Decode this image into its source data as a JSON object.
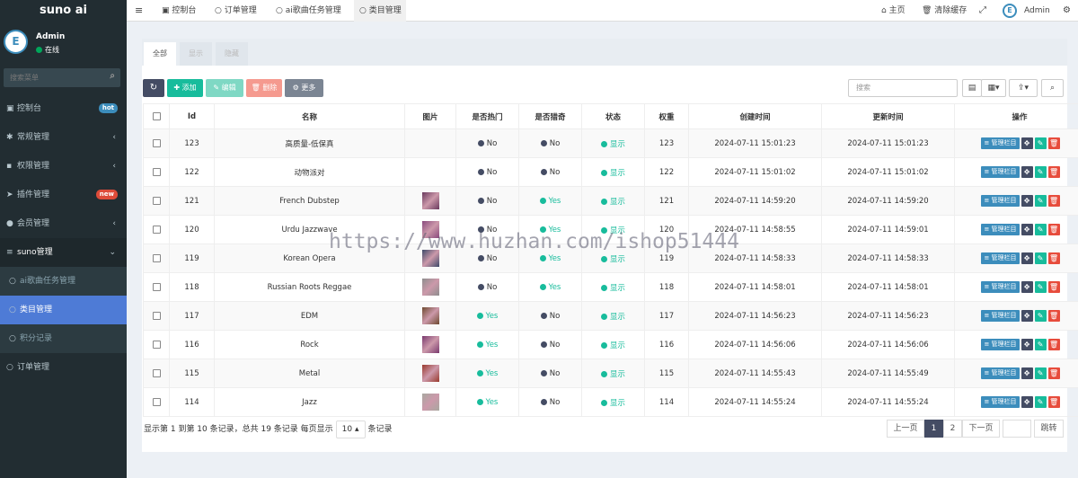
{
  "sidebar": {
    "logo": "suno ai",
    "avatar_text": "E",
    "user_name": "Admin",
    "user_status": "在线",
    "search_placeholder": "搜索菜单",
    "items": [
      {
        "icon": "dashboard-icon",
        "glyph": "▣",
        "label": "控制台",
        "badge": "hot",
        "badge_color": "#3c8dbc"
      },
      {
        "icon": "cogs-icon",
        "glyph": "✱",
        "label": "常规管理",
        "arrow": "‹"
      },
      {
        "icon": "group-icon",
        "glyph": "▪",
        "label": "权限管理",
        "arrow": "‹"
      },
      {
        "icon": "rocket-icon",
        "glyph": "➤",
        "label": "插件管理",
        "badge": "new",
        "badge_color": "#dd4b39"
      },
      {
        "icon": "user-circle-icon",
        "glyph": "●",
        "label": "会员管理",
        "arrow": "‹"
      },
      {
        "icon": "list-icon",
        "glyph": "≡",
        "label": "suno管理",
        "arrow": "⌄"
      }
    ],
    "subitems": [
      {
        "label": "ai歌曲任务管理",
        "active": false
      },
      {
        "label": "类目管理",
        "active": true
      },
      {
        "label": "积分记录",
        "active": false
      }
    ],
    "last_item": {
      "icon": "circle-icon",
      "label": "订单管理"
    }
  },
  "topbar": {
    "tabs": [
      {
        "label": "控制台",
        "icon": "dashboard-icon",
        "glyph": "▣"
      },
      {
        "label": "订单管理",
        "icon": "circle-icon",
        "glyph": "○"
      },
      {
        "label": "ai歌曲任务管理",
        "icon": "circle-icon",
        "glyph": "○"
      },
      {
        "label": "类目管理",
        "icon": "circle-icon",
        "glyph": "○"
      }
    ],
    "home": "主页",
    "clear_cache": "清除缓存",
    "admin": "Admin"
  },
  "content_tabs": [
    "全部",
    "显示",
    "隐藏"
  ],
  "toolbar": {
    "add": "添加",
    "edit": "编辑",
    "delete": "删除",
    "more": "更多",
    "search_placeholder": "搜索"
  },
  "table": {
    "headers": [
      "Id",
      "名称",
      "图片",
      "是否热门",
      "是否猎奇",
      "状态",
      "权重",
      "创建时间",
      "更新时间",
      "操作"
    ],
    "rows": [
      {
        "id": "123",
        "name": "高质量-低保真",
        "img": "",
        "hot": "No",
        "odd": "No",
        "status": "显示",
        "weight": "123",
        "created": "2024-07-11 15:01:23",
        "updated": "2024-07-11 15:01:23"
      },
      {
        "id": "122",
        "name": "动物派对",
        "img": "",
        "hot": "No",
        "odd": "No",
        "status": "显示",
        "weight": "122",
        "created": "2024-07-11 15:01:02",
        "updated": "2024-07-11 15:01:02"
      },
      {
        "id": "121",
        "name": "French Dubstep",
        "img": "#6a3a5e",
        "hot": "No",
        "odd": "Yes",
        "status": "显示",
        "weight": "121",
        "created": "2024-07-11 14:59:20",
        "updated": "2024-07-11 14:59:20"
      },
      {
        "id": "120",
        "name": "Urdu Jazzwave",
        "img": "#8a4a7e",
        "hot": "No",
        "odd": "Yes",
        "status": "显示",
        "weight": "120",
        "created": "2024-07-11 14:58:55",
        "updated": "2024-07-11 14:59:01"
      },
      {
        "id": "119",
        "name": "Korean Opera",
        "img": "#3e4a6a",
        "hot": "No",
        "odd": "Yes",
        "status": "显示",
        "weight": "119",
        "created": "2024-07-11 14:58:33",
        "updated": "2024-07-11 14:58:33"
      },
      {
        "id": "118",
        "name": "Russian Roots Reggae",
        "img": "#8e8e8e",
        "hot": "No",
        "odd": "Yes",
        "status": "显示",
        "weight": "118",
        "created": "2024-07-11 14:58:01",
        "updated": "2024-07-11 14:58:01"
      },
      {
        "id": "117",
        "name": "EDM",
        "img": "#6e4a30",
        "hot": "Yes",
        "odd": "No",
        "status": "显示",
        "weight": "117",
        "created": "2024-07-11 14:56:23",
        "updated": "2024-07-11 14:56:23"
      },
      {
        "id": "116",
        "name": "Rock",
        "img": "#7a3a6e",
        "hot": "Yes",
        "odd": "No",
        "status": "显示",
        "weight": "116",
        "created": "2024-07-11 14:56:06",
        "updated": "2024-07-11 14:56:06"
      },
      {
        "id": "115",
        "name": "Metal",
        "img": "#9a3a2e",
        "hot": "Yes",
        "odd": "No",
        "status": "显示",
        "weight": "115",
        "created": "2024-07-11 14:55:43",
        "updated": "2024-07-11 14:55:49"
      },
      {
        "id": "114",
        "name": "Jazz",
        "img": "#a8a8a0",
        "hot": "Yes",
        "odd": "No",
        "status": "显示",
        "weight": "114",
        "created": "2024-07-11 14:55:24",
        "updated": "2024-07-11 14:55:24"
      }
    ],
    "action_label": "管理栏目"
  },
  "footer": {
    "summary": "显示第 1 到第 10 条记录，总共 19 条记录 每页显示",
    "page_size": "10",
    "suffix": "条记录"
  },
  "pagination": {
    "prev": "上一页",
    "pages": [
      "1",
      "2"
    ],
    "current": "1",
    "next": "下一页",
    "jump": "跳转"
  },
  "watermark": "https://www.huzhan.com/ishop51444",
  "colors": {
    "sidebar_bg": "#222d32",
    "active_menu": "#4e7bd6",
    "refresh": "#444c64",
    "add": "#18bc9c",
    "edit": "#7fd8c4",
    "delete": "#f59a8f",
    "more": "#7b8593",
    "action_blue": "#3c8dbc",
    "action_dark": "#444c64",
    "action_green": "#18bc9c",
    "action_red": "#e74c3c"
  }
}
